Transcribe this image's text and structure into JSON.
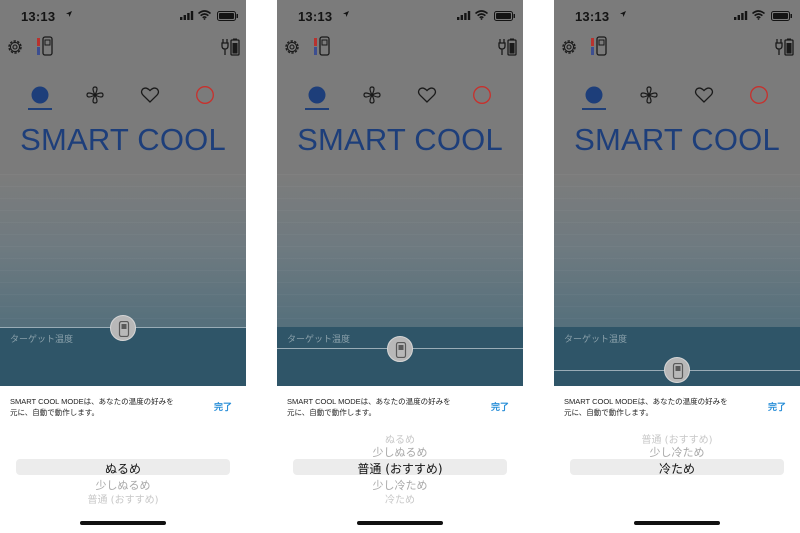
{
  "status": {
    "time": "13:13"
  },
  "app": {
    "title": "SMART COOL",
    "target_label": "ターゲット温度"
  },
  "sheet": {
    "info_line1": "SMART COOL MODEは、あなたの温度の好みを",
    "info_line2": "元に、自動で動作します。",
    "done_label": "完了"
  },
  "picker_options": [
    "ぬるめ",
    "少しぬるめ",
    "普通 (おすすめ)",
    "少し冷ため",
    "冷ため"
  ],
  "screens": [
    {
      "selected": "ぬるめ",
      "selected_index": 0,
      "row_below_1": "少しぬるめ",
      "row_below_2": "普通 (おすすめ)"
    },
    {
      "selected": "普通 (おすすめ)",
      "selected_index": 2,
      "row_above_2": "ぬるめ",
      "row_above_1": "少しぬるめ",
      "row_below_1": "少し冷ため",
      "row_below_2": "冷ため"
    },
    {
      "selected": "冷ため",
      "selected_index": 4,
      "row_above_2": "普通 (おすすめ)",
      "row_above_1": "少し冷ため"
    }
  ],
  "colors": {
    "accent": "#1d3e7a",
    "done": "#2a8fd8",
    "off_ring": "#c8302c",
    "dim_overlay": "#7b7b7b"
  },
  "icons": {
    "status": [
      "location-arrow-icon",
      "signal-icon",
      "wifi-icon",
      "battery-icon"
    ],
    "toolbar": [
      "gear-icon",
      "remote-icon",
      "plug-battery-icon"
    ],
    "modes": [
      "cool-mode-icon",
      "fan-icon",
      "heart-icon",
      "power-off-icon"
    ]
  }
}
